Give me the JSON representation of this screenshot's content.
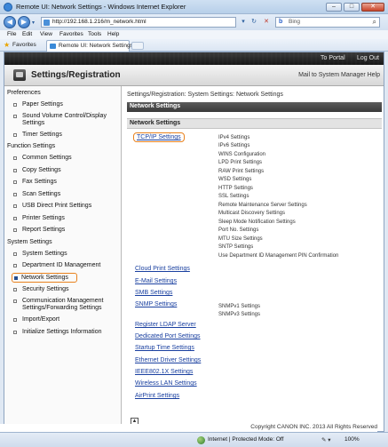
{
  "window": {
    "title": "Remote UI: Network Settings - Windows Internet Explorer",
    "btn_min": "–",
    "btn_max": "□",
    "btn_close": "✕"
  },
  "address_bar": {
    "url": "http://192.168.1.216/m_network.html",
    "search_text": "Bing"
  },
  "menu": [
    "File",
    "Edit",
    "View",
    "Favorites",
    "Tools",
    "Help"
  ],
  "favorites_bar": {
    "label": "Favorites",
    "tab_title": "Remote UI: Network Settings"
  },
  "top_links": {
    "portal": "To Portal",
    "logout": "Log Out"
  },
  "header": {
    "title": "Settings/Registration",
    "links": "Mail to System Manager  Help"
  },
  "sidebar": {
    "sections": [
      {
        "title": "Preferences",
        "items": [
          "Paper Settings",
          "Sound Volume Control/Display Settings",
          "Timer Settings"
        ]
      },
      {
        "title": "Function Settings",
        "items": [
          "Common Settings",
          "Copy Settings",
          "Fax Settings",
          "Scan Settings",
          "USB Direct Print Settings",
          "Printer Settings",
          "Report Settings"
        ]
      },
      {
        "title": "System Settings",
        "items": [
          "System Settings",
          "Department ID Management",
          "Network Settings",
          "Security Settings",
          "Communication Management Settings/Forwarding Settings",
          "Import/Export",
          "Initialize Settings Information"
        ]
      }
    ],
    "active": "Network Settings"
  },
  "main": {
    "breadcrumb": "Settings/Registration: System Settings: Network Settings",
    "bar_title": "Network Settings",
    "section_title": "Network Settings",
    "links": [
      {
        "label": "TCP/IP Settings",
        "sub": [
          "IPv4 Settings",
          "IPv6 Settings",
          "WINS Configuration",
          "LPD Print Settings",
          "RAW Print Settings",
          "WSD Settings",
          "HTTP Settings",
          "SSL Settings",
          "Remote Maintenance Server Settings",
          "Multicast Discovery Settings",
          "Sleep Mode Notification Settings",
          "Port No. Settings",
          "MTU Size Settings",
          "SNTP Settings",
          "Use Department ID Management PIN Confirmation"
        ]
      },
      {
        "label": "Cloud Print Settings"
      },
      {
        "label": "E-Mail Settings"
      },
      {
        "label": "SMB Settings"
      },
      {
        "label": "SNMP Settings",
        "sub": [
          "SNMPv1 Settings",
          "SNMPv3 Settings"
        ]
      },
      {
        "label": "Register LDAP Server"
      },
      {
        "label": "Dedicated Port Settings"
      },
      {
        "label": "Startup Time Settings"
      },
      {
        "label": "Ethernet Driver Settings"
      },
      {
        "label": "IEEE802.1X Settings"
      },
      {
        "label": "Wireless LAN Settings"
      },
      {
        "label": "AirPrint Settings"
      }
    ],
    "top_button": "▲"
  },
  "footer": {
    "copyright": "Copyright CANON INC. 2013 All Rights Reserved"
  },
  "statusbar": {
    "zone": "Internet | Protected Mode: Off",
    "zoom": "100%",
    "controls": "✎ ▾"
  }
}
